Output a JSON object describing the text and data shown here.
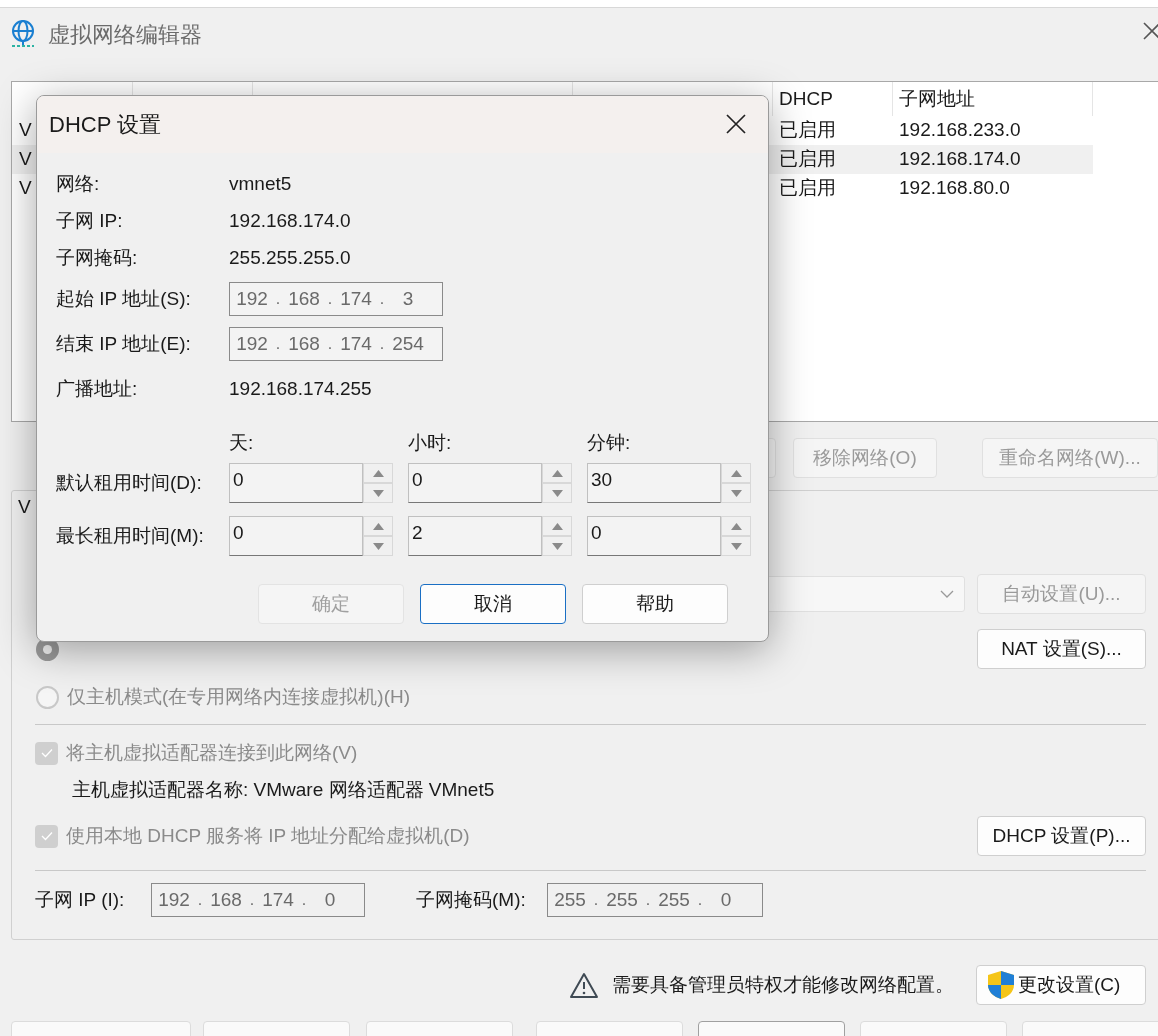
{
  "window": {
    "title": "虚拟网络编辑器"
  },
  "table": {
    "columns": [
      "DHCP",
      "子网地址"
    ],
    "rows": [
      {
        "name": "V",
        "dhcp": "已启用",
        "subnet": "192.168.233.0",
        "selected": false
      },
      {
        "name": "V",
        "dhcp": "已启用",
        "subnet": "192.168.174.0",
        "selected": true
      },
      {
        "name": "V",
        "dhcp": "已启用",
        "subnet": "192.168.80.0",
        "selected": false
      }
    ]
  },
  "network_buttons": [
    {
      "label": "移除网络(O)",
      "disabled": true
    },
    {
      "label": "重命名网络(W)...",
      "disabled": true
    }
  ],
  "settings": {
    "group_label": "V",
    "auto_button": {
      "label": "自动设置(U)...",
      "disabled": true
    },
    "nat_radio": {
      "selected": true
    },
    "nat_button": {
      "label": "NAT 设置(S)...",
      "disabled": false
    },
    "host_only_radio": {
      "label": "仅主机模式(在专用网络内连接虚拟机)(H)",
      "selected": false
    },
    "connect_adapter": {
      "label": "将主机虚拟适配器连接到此网络(V)",
      "checked": true,
      "disabled": true
    },
    "adapter_name": "主机虚拟适配器名称: VMware 网络适配器 VMnet5",
    "use_dhcp": {
      "label": "使用本地 DHCP 服务将 IP 地址分配给虚拟机(D)",
      "checked": true,
      "disabled": true
    },
    "dhcp_button": {
      "label": "DHCP 设置(P)...",
      "disabled": false
    },
    "subnet_ip": {
      "label": "子网 IP (I):",
      "octets": [
        "192",
        "168",
        "174",
        "0"
      ],
      "separator": "."
    },
    "subnet_mask": {
      "label": "子网掩码(M):",
      "octets": [
        "255",
        "255",
        "255",
        "0"
      ],
      "separator": "."
    }
  },
  "admin_notice": "需要具备管理员特权才能修改网络配置。",
  "change_settings_button": "更改设置(C)",
  "dialog": {
    "title": "DHCP 设置",
    "info": [
      {
        "label": "网络:",
        "value": "vmnet5"
      },
      {
        "label": "子网 IP:",
        "value": "192.168.174.0"
      },
      {
        "label": "子网掩码:",
        "value": "255.255.255.0"
      }
    ],
    "start_ip": {
      "label": "起始 IP 地址(S):",
      "octets": [
        "192",
        "168",
        "174",
        "3"
      ],
      "separator": "."
    },
    "end_ip": {
      "label": "结束 IP 地址(E):",
      "octets": [
        "192",
        "168",
        "174",
        "254"
      ],
      "separator": "."
    },
    "broadcast": {
      "label": "广播地址:",
      "value": "192.168.174.255"
    },
    "lease_headers": [
      "天:",
      "小时:",
      "分钟:"
    ],
    "leases": [
      {
        "label": "默认租用时间(D):",
        "values": [
          "0",
          "0",
          "30"
        ]
      },
      {
        "label": "最长租用时间(M):",
        "values": [
          "0",
          "2",
          "0"
        ]
      }
    ],
    "buttons": [
      {
        "label": "确定",
        "disabled": true,
        "default": false
      },
      {
        "label": "取消",
        "disabled": false,
        "default": true
      },
      {
        "label": "帮助",
        "disabled": false,
        "default": false
      }
    ]
  }
}
